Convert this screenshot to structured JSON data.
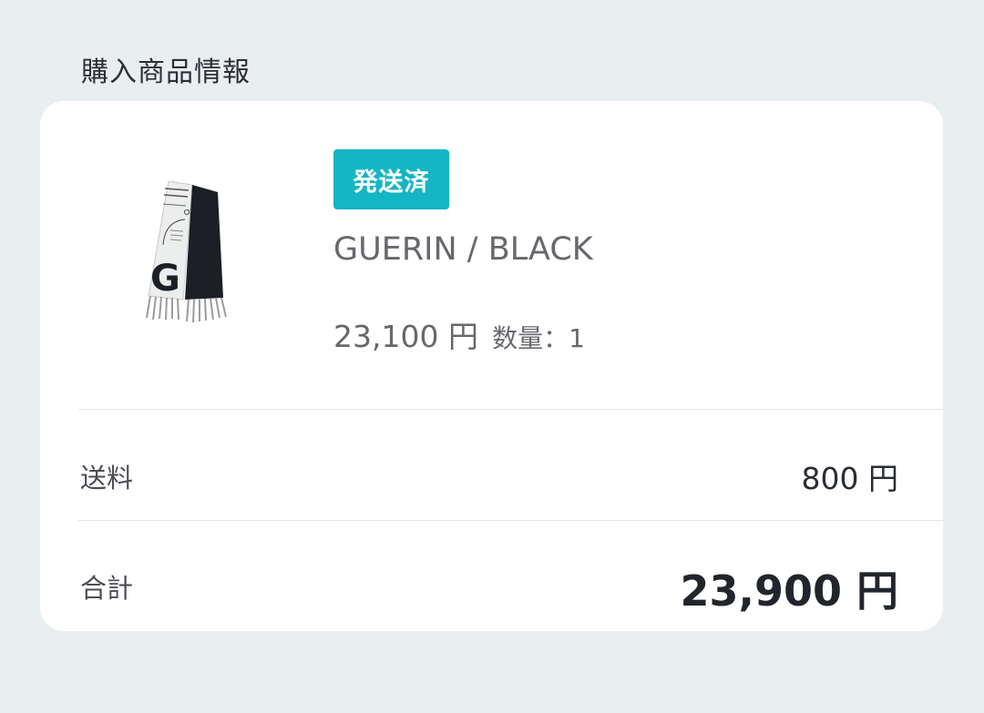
{
  "section": {
    "title": "購入商品情報"
  },
  "product": {
    "status_badge": "発送済",
    "name": "GUERIN / BLACK",
    "price": "23,100 円",
    "quantity_label": "数量：1",
    "image_icon": "scarf-product-image"
  },
  "summary": {
    "shipping_label": "送料",
    "shipping_value": "800 円",
    "total_label": "合計",
    "total_value": "23,900 円"
  },
  "colors": {
    "background": "#e9eef0",
    "card": "#ffffff",
    "badge": "#14b5c4"
  }
}
